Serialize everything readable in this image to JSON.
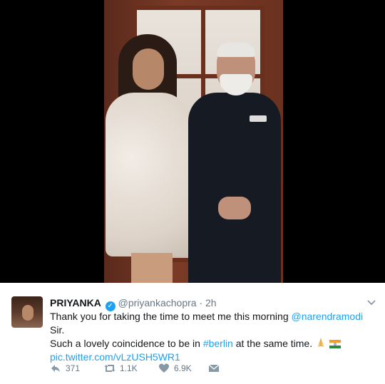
{
  "tweet": {
    "display_name": "PRIYANKA",
    "handle": "@priyankachopra",
    "separator": "·",
    "time": "2h",
    "text_part1": "Thank you for taking the time to meet me this morning ",
    "mention": "@narendramodi",
    "text_part2": " Sir.",
    "text_part3": "Such a lovely coincidence to be in ",
    "hashtag": "#berlin",
    "text_part4": " at the same time.",
    "link": "pic.twitter.com/vLzUSH5WR1",
    "emojis": [
      "folded-hands",
      "india-flag"
    ]
  },
  "actions": {
    "reply_count": "371",
    "retweet_count": "1.1K",
    "like_count": "6.9K"
  },
  "icons": {
    "verified": "verified-badge-icon",
    "more": "chevron-down-icon",
    "reply": "reply-icon",
    "retweet": "retweet-icon",
    "like": "heart-icon",
    "dm": "envelope-icon"
  },
  "colors": {
    "link_blue": "#1da1f2",
    "muted_gray": "#657786",
    "text": "#14171a"
  }
}
